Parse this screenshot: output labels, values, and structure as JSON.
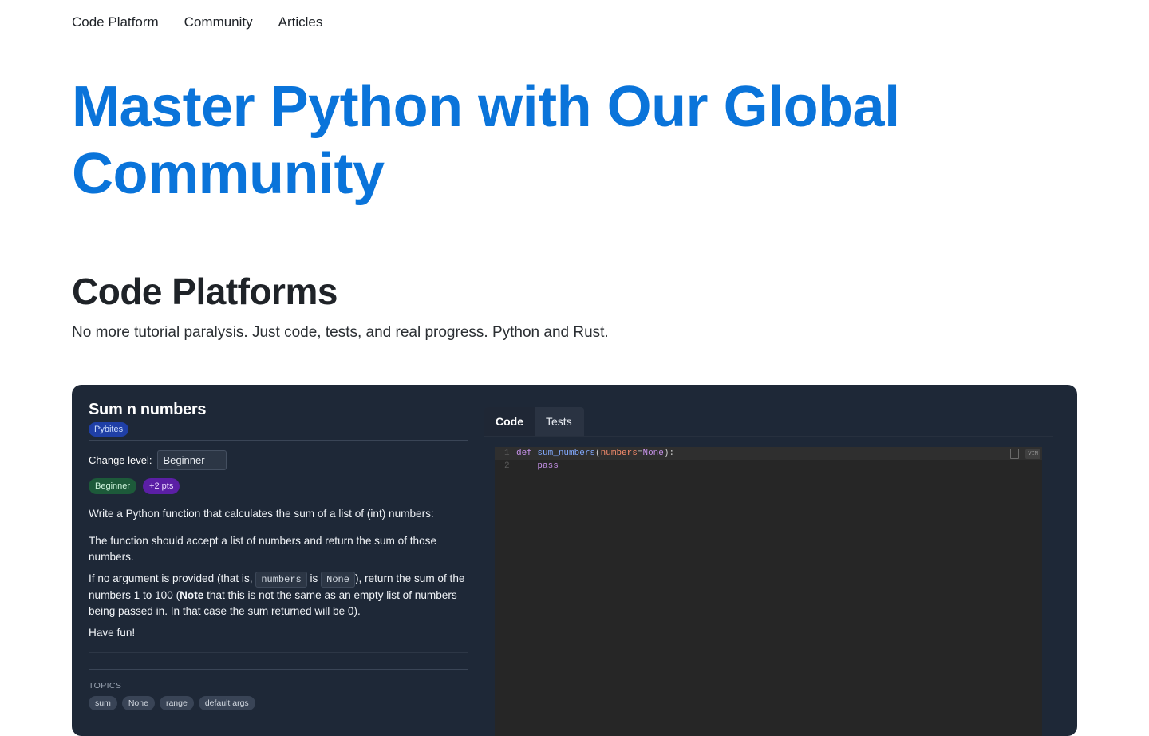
{
  "nav": {
    "items": [
      "Code Platform",
      "Community",
      "Articles"
    ]
  },
  "hero": {
    "title_line1": "Master Python with Our Global",
    "title_line2": "Community"
  },
  "section": {
    "title": "Code Platforms",
    "subtitle": "No more tutorial paralysis. Just code, tests, and real progress. Python and Rust."
  },
  "exercise": {
    "title": "Sum n numbers",
    "source_badge": "Pybites",
    "change_level_label": "Change level:",
    "level_value": "Beginner",
    "level_badge": "Beginner",
    "points_badge": "+2 pts",
    "paragraph1": "Write a Python function that calculates the sum of a list of (int) numbers:",
    "paragraph2": "The function should accept a list of numbers and return the sum of those numbers.",
    "p3_a": "If no argument is provided (that is,",
    "p3_code1": "numbers",
    "p3_is": "is",
    "p3_code2": "None",
    "p3_b": "), return the sum of the numbers 1 to 100 (",
    "p3_note": "Note",
    "p3_c": " that this is not the same as an empty list of numbers being passed in. In that case the sum returned will be 0).",
    "paragraph4": "Have fun!",
    "topics_label": "TOPICS",
    "topics": [
      "sum",
      "None",
      "range",
      "default args"
    ]
  },
  "editor": {
    "tabs": [
      "Code",
      "Tests"
    ],
    "active_tab": "Code",
    "vim_label": "VIM",
    "line1_no": "1",
    "line1_kw": "def",
    "line1_fn": "sum_numbers",
    "line1_paren": "(",
    "line1_param": "numbers",
    "line1_eq": "=",
    "line1_none": "None",
    "line1_end": "):",
    "line2_no": "2",
    "line2_code": "pass"
  },
  "colors": {
    "brand": "#0a74da",
    "panel_bg": "#1e2837",
    "editor_bg": "#262626"
  }
}
